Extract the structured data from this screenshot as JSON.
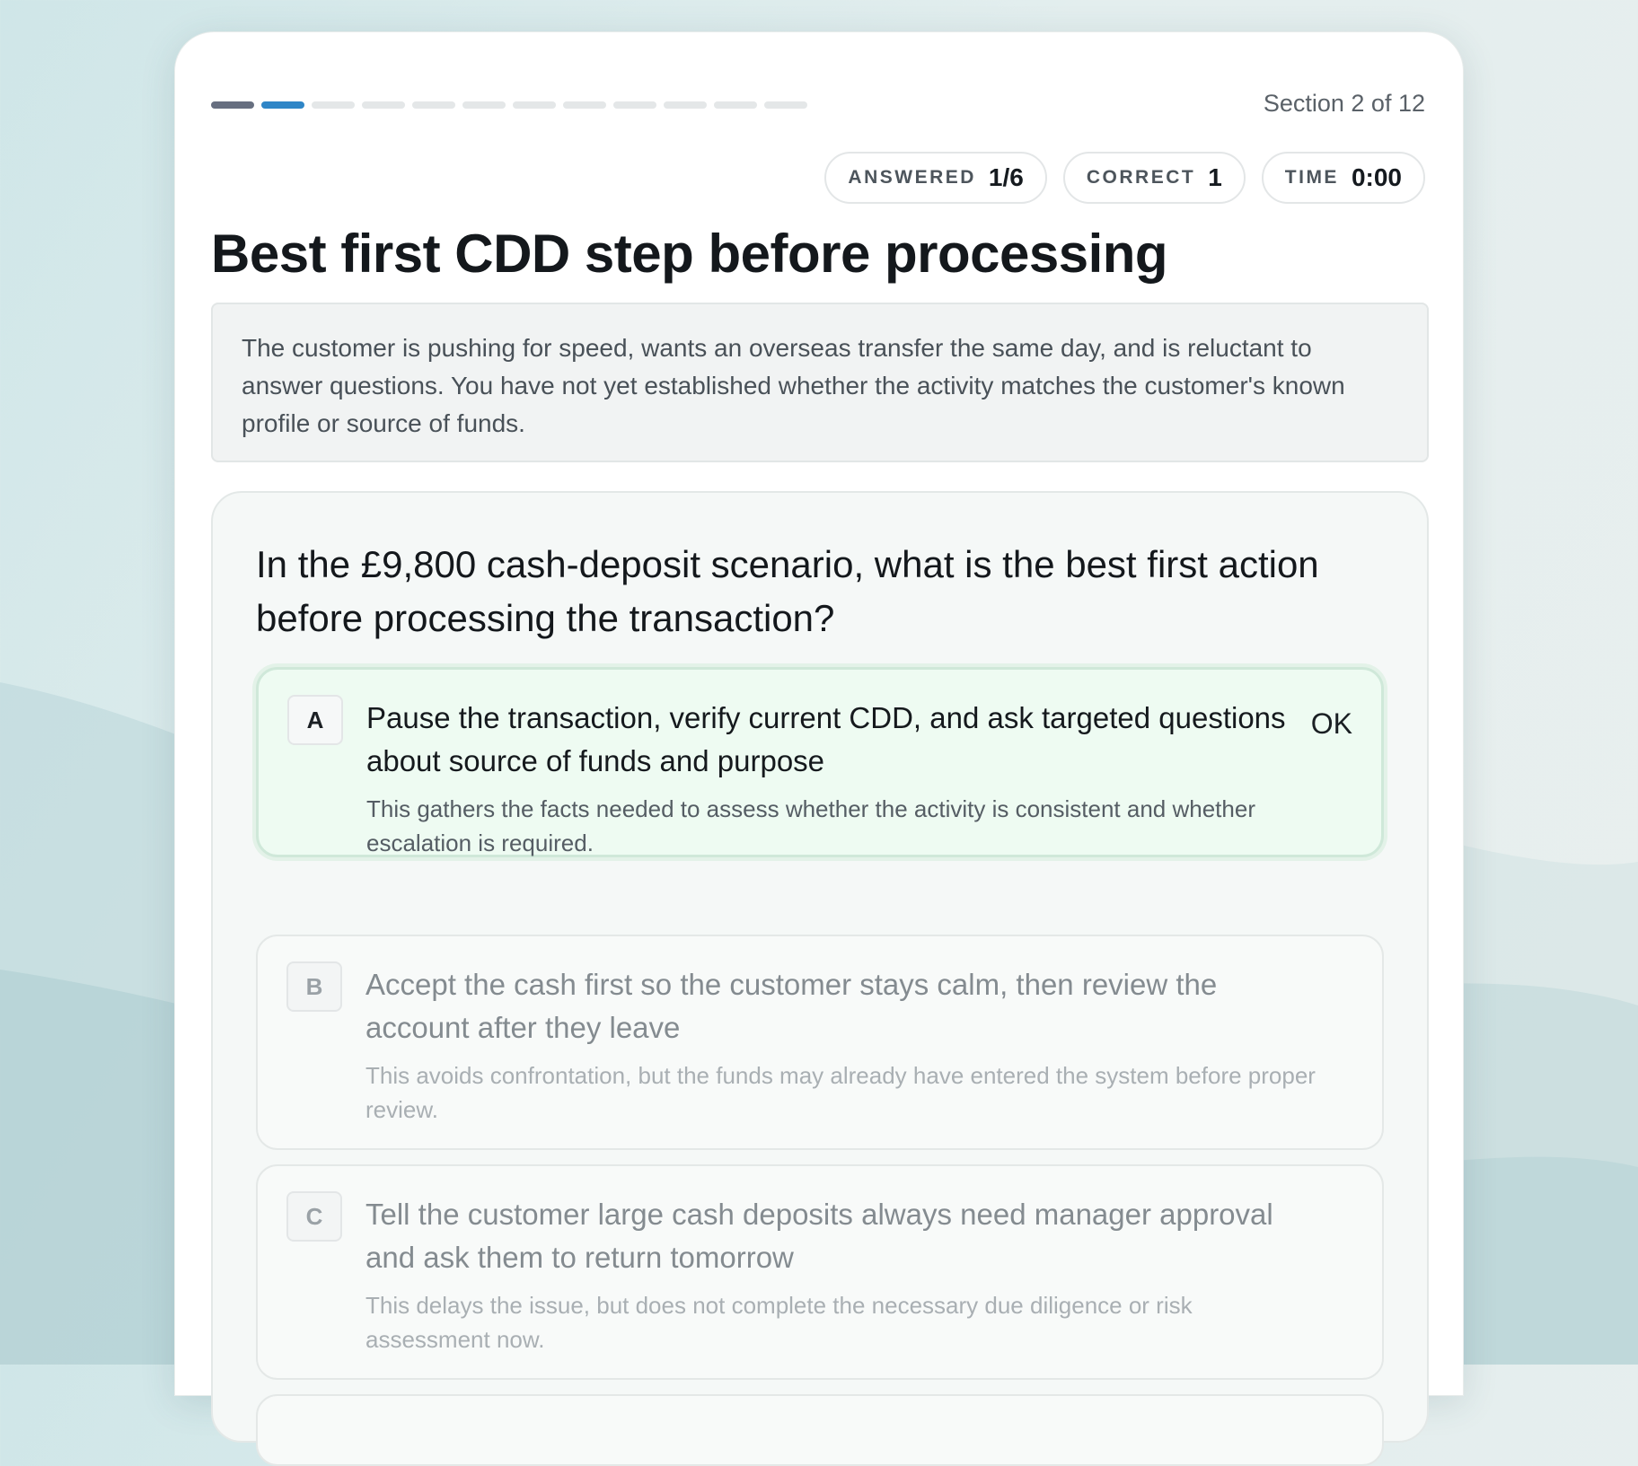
{
  "progress": {
    "total_segments": 12,
    "current_segment": 2,
    "colors": {
      "done": "#676f80",
      "current": "#2f86c7",
      "pending": "#e4e7e8"
    }
  },
  "header": {
    "section_label": "Section 2 of 12"
  },
  "stats": [
    {
      "label": "ANSWERED",
      "value": "1/6"
    },
    {
      "label": "CORRECT",
      "value": "1"
    },
    {
      "label": "TIME",
      "value": "0:00"
    }
  ],
  "title": "Best first CDD step before processing",
  "scenario": "The customer is pushing for speed, wants an overseas transfer the same day, and is reluctant to answer questions. You have not yet established whether the activity matches the customer's known profile or source of funds.",
  "question": "In the £9,800 cash-deposit scenario, what is the best first action before processing the transaction?",
  "options": [
    {
      "letter": "A",
      "text": "Pause the transaction, verify current CDD, and ask targeted questions about source of funds and purpose",
      "explanation": "This gathers the facts needed to assess whether the activity is consistent and whether escalation is required.",
      "status": "OK"
    },
    {
      "letter": "B",
      "text": "Accept the cash first so the customer stays calm, then review the account after they leave",
      "explanation": "This avoids confrontation, but the funds may already have entered the system before proper review."
    },
    {
      "letter": "C",
      "text": "Tell the customer large cash deposits always need manager approval and ask them to return tomorrow",
      "explanation": "This delays the issue, but does not complete the necessary due diligence or risk assessment now."
    }
  ]
}
